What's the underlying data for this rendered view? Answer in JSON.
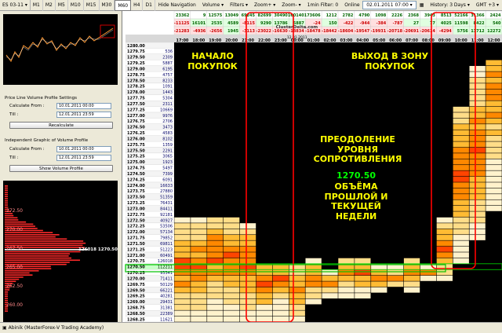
{
  "toolbar": {
    "symbol": "ES 03-11",
    "timeframes": [
      "M1",
      "M2",
      "M5",
      "M10",
      "M15",
      "M30",
      "M60",
      "H4",
      "D1"
    ],
    "active_timeframe": "M60",
    "hide_nav": "Hide Navigation",
    "volume": "Volume",
    "filters": "Filters",
    "zoom_in": "Zoom+",
    "zoom_out": "Zoom-",
    "filter_text": "1min Filter: 0",
    "online": "Online",
    "datetime": "02.01.2011 07:00",
    "history": "History: 3 Days",
    "gmt": "GMT +3"
  },
  "left": {
    "section1_title": "Price Line Volume Profile Settings",
    "calc_from_label": "Calculate From :",
    "till_label": "Till :",
    "calc_from_value": "10.01.2011 00:00",
    "till_value": "12.01.2011 23:59",
    "recalc_button": "Recalculate",
    "section2_title": "Independent Graphic of Volume Profile",
    "calc_from_label2": "Calculate From :",
    "till_label2": "Till :",
    "calc_from_value2": "10.01.2011 00:00",
    "till_value2": "12.01.2011 23:59",
    "show_button": "Show Volume Profile",
    "profile_levels": [
      "272.50",
      "270.00",
      "267.50",
      "265.00",
      "262.50",
      "260.00"
    ],
    "profile_highlight": "126018 1270.50",
    "accent": "#ff0000"
  },
  "grid": {
    "stats_row1": [
      "23362",
      "9",
      "12575",
      "13049",
      "69245",
      "82699",
      "30490",
      "160140",
      "173606",
      "1212",
      "2782",
      "4790",
      "1098",
      "2226",
      "2368",
      "3943",
      "8513",
      "52166",
      "31366",
      "2424"
    ],
    "stats_row2": [
      "-11125",
      "16101",
      "2535",
      "4589",
      "-8115",
      "9290",
      "13786",
      "5887",
      "-24",
      "150",
      "-422",
      "-944",
      "-384",
      "-787",
      "27",
      "77",
      "4025",
      "11598",
      "8422",
      "540"
    ],
    "stats_row3": [
      "-21283",
      "-4936",
      "-2656",
      "1945",
      "-3113",
      "-23022",
      "-16630",
      "-18834",
      "-18478",
      "-18442",
      "-18604",
      "-19547",
      "-19931",
      "-20718",
      "-20691",
      "-20614",
      "-4294",
      "5756",
      "13712",
      "12272"
    ],
    "site": "ClusterDelta.com",
    "date_label": "12.01.2011",
    "times": [
      "17:00",
      "18:00",
      "19:00",
      "20:00",
      "21:00",
      "22:00",
      "23:00",
      "00:00",
      "01:00",
      "02:00",
      "03:00",
      "04:00",
      "05:00",
      "06:00",
      "07:00",
      "08:00",
      "09:00",
      "10:00",
      "11:00",
      "12:00",
      "13:00"
    ],
    "prices": [
      "1280.00",
      "1279.75",
      "1279.50",
      "1279.25",
      "1279.00",
      "1278.75",
      "1278.50",
      "1278.25",
      "1278.00",
      "1277.75",
      "1277.50",
      "1277.25",
      "1277.00",
      "1276.75",
      "1276.50",
      "1276.25",
      "1276.00",
      "1275.75",
      "1275.50",
      "1275.25",
      "1275.00",
      "1274.75",
      "1274.50",
      "1274.25",
      "1274.00",
      "1273.75",
      "1273.50",
      "1273.25",
      "1273.00",
      "1272.75",
      "1272.50",
      "1272.25",
      "1272.00",
      "1271.75",
      "1271.50",
      "1271.25",
      "1271.00",
      "1270.75",
      "1270.50",
      "1270.25",
      "1270.00",
      "1269.75",
      "1269.50",
      "1269.25",
      "1269.00",
      "1268.75",
      "1268.50",
      "1268.25"
    ],
    "price_volumes": [
      "",
      "536",
      "2309",
      "5887",
      "6195",
      "4757",
      "8233",
      "1091",
      "1443",
      "5304",
      "2311",
      "10669",
      "9976",
      "2706",
      "3473",
      "4583",
      "8102",
      "1359",
      "2291",
      "3065",
      "1923",
      "5497",
      "7399",
      "6091",
      "16633",
      "27880",
      "51359",
      "76431",
      "84411",
      "92181",
      "40927",
      "53506",
      "57134",
      "79852",
      "69811",
      "51223",
      "60491",
      "126018",
      "112211",
      "93341",
      "71411",
      "50129",
      "66221",
      "40281",
      "29431",
      "31381",
      "22389",
      "11621"
    ],
    "highlight_price": "1270.50",
    "highlight_volume": "126018",
    "highlight_color": "#00aa00"
  },
  "annotations": {
    "start_buy": "НАЧАЛО ПОКУПОК",
    "exit_zone": "ВЫХОД В ЗОНУ ПОКУПОК",
    "overcome": "ПРЕОДОЛЕНИЕ УРОВНЯ СОПРОТИВЛЕНИЯ",
    "level": "1270.50",
    "volumes": "ОБЪЁМА ПРОШЛОЙ И ТЕКУЩЕЙ НЕДЕЛИ",
    "yellow": "#ffff00",
    "green": "#00ff00"
  },
  "status": {
    "text": "Abinik (MasterForex-V Trading Academy)"
  }
}
